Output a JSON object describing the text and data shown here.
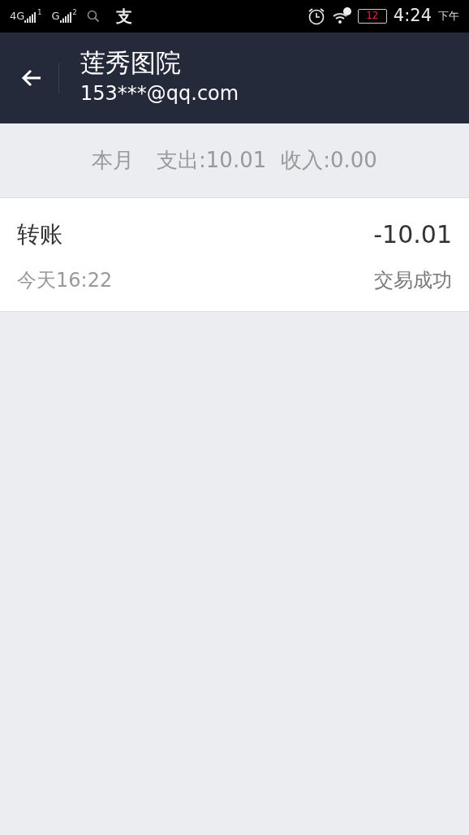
{
  "status_bar": {
    "sim1": {
      "network": "4G",
      "slot": "1"
    },
    "sim2": {
      "network": "G",
      "slot": "2"
    },
    "app_glyph": "支",
    "battery": "12",
    "time": "4:24",
    "period": "下午"
  },
  "header": {
    "title": "莲秀图院",
    "subtitle": "153***@qq.com"
  },
  "summary": {
    "period": "本月",
    "expense": "支出:10.01",
    "income": "收入:0.00"
  },
  "transactions": [
    {
      "title": "转账",
      "amount": "-10.01",
      "time": "今天16:22",
      "status": "交易成功"
    }
  ]
}
